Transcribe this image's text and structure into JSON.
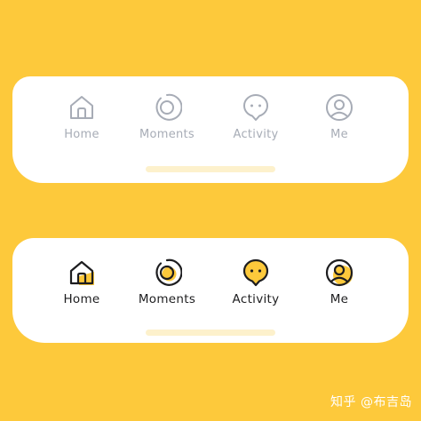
{
  "colors": {
    "background": "#FDC93B",
    "bar": "#FFFFFF",
    "inactive": "#A7ACB6",
    "active_text": "#1D1D1F",
    "accent": "#FDC93B",
    "home_indicator": "#FDF1CC"
  },
  "tabbar_inactive": {
    "tabs": [
      {
        "label": "Home",
        "icon": "home-icon"
      },
      {
        "label": "Moments",
        "icon": "moments-icon"
      },
      {
        "label": "Activity",
        "icon": "activity-icon"
      },
      {
        "label": "Me",
        "icon": "profile-icon"
      }
    ]
  },
  "tabbar_active": {
    "tabs": [
      {
        "label": "Home",
        "icon": "home-icon"
      },
      {
        "label": "Moments",
        "icon": "moments-icon"
      },
      {
        "label": "Activity",
        "icon": "activity-icon"
      },
      {
        "label": "Me",
        "icon": "profile-icon"
      }
    ]
  },
  "watermark": {
    "text": "知乎 @布吉岛"
  }
}
